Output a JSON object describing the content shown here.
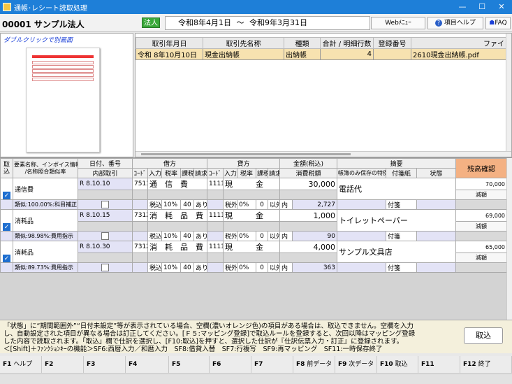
{
  "window": {
    "title": "通帳･レシート読取処理",
    "controls": [
      "—",
      "☐",
      "✕"
    ]
  },
  "header": {
    "company": "00001 サンプル法人",
    "entity_type": "法人",
    "period_start": "令和8年4月1日",
    "period_sep": "〜",
    "period_end": "令和9年3月31日",
    "web_menu": "Webﾒﾆｭｰ",
    "help": "項目ヘルプ",
    "faq": "FAQ"
  },
  "preview": {
    "hint": "ダブルクリックで別画面"
  },
  "list": {
    "columns": [
      "取引年月日",
      "取引先名称",
      "種類",
      "合計 / 明細行数",
      "登録番号",
      "ファイ"
    ],
    "rows": [
      {
        "date": "令和 8年10月10日",
        "name": "現金出納帳",
        "kind": "出納帳",
        "count": "4",
        "reg": "",
        "file": "2610現金出納帳.pdf"
      }
    ]
  },
  "grid": {
    "headers": {
      "tori": "取",
      "komi": "込",
      "element": "要素名称、インボイス情報",
      "element2": "/名称照合類似率",
      "date": "日付、番号",
      "internal": "内部取引",
      "debit": "借方",
      "credit": "貸方",
      "code": "ｺｰﾄﾞ",
      "input": "入力",
      "taxrate": "税率",
      "taxcls": "課税",
      "bill": "請求",
      "amount": "金額(税込)",
      "tax": "消費税額",
      "summary": "摘要",
      "special": "帳簿のみ保存の特例",
      "tag": "付箋紙",
      "state": "状態",
      "balance": "残高確認"
    },
    "rows": [
      {
        "name": "通信費",
        "match": "類似:100.00%:科目補正",
        "era": "R",
        "m": "8",
        "d": "10",
        "n": "10",
        "dr_code": "7513",
        "dr_name": "通　信　費",
        "dr_input": "税込",
        "dr_rate": "10%",
        "dr_cls": "40",
        "dr_bill": "あり",
        "cr_code": "1111",
        "cr_name": "現　　　金",
        "cr_input": "税外",
        "cr_rate": "0%",
        "cr_cls": "0",
        "cr_bill": "以外",
        "amount": "30,000",
        "in": "内",
        "tax": "2,727",
        "summary": "電話代",
        "tag": "付箋",
        "balance": "70,000",
        "reduce": "減額"
      },
      {
        "name": "消耗品",
        "match": "類似:98.98%:費用指示",
        "era": "R",
        "m": "8",
        "d": "10",
        "n": "15",
        "dr_code": "7312",
        "dr_name": "消　耗　品　費",
        "dr_input": "税込",
        "dr_rate": "10%",
        "dr_cls": "40",
        "dr_bill": "あり",
        "cr_code": "1111",
        "cr_name": "現　　　金",
        "cr_input": "税外",
        "cr_rate": "0%",
        "cr_cls": "0",
        "cr_bill": "以外",
        "amount": "1,000",
        "in": "内",
        "tax": "90",
        "summary": "トイレットペーパー",
        "tag": "付箋",
        "balance": "69,000",
        "reduce": "減額"
      },
      {
        "name": "消耗品",
        "match": "類似:89.73%:費用指示",
        "era": "R",
        "m": "8",
        "d": "10",
        "n": "30",
        "dr_code": "7312",
        "dr_name": "消　耗　品　費",
        "dr_input": "税込",
        "dr_rate": "10%",
        "dr_cls": "40",
        "dr_bill": "あり",
        "cr_code": "1111",
        "cr_name": "現　　　金",
        "cr_input": "税外",
        "cr_rate": "0%",
        "cr_cls": "0",
        "cr_bill": "以外",
        "amount": "4,000",
        "in": "内",
        "tax": "363",
        "summary": "サンプル文具店",
        "tag": "付箋",
        "balance": "65,000",
        "reduce": "減額"
      }
    ]
  },
  "message": {
    "line1": "「状態」に“期間範囲外”“日付未設定”等が表示されている場合、空欄(濃いオレンジ色)の項目がある場合は、取込できません。空欄を入力",
    "line2": "し、自動設定された項目が異なる場合は訂正してください。[Ｆ５:マッピング登録]で取込ルールを登録すると、次回以降はマッピング登録",
    "line3": "した内容で読取されます。「取込」欄で仕訳を選択し、[F10:取込]を押すと、選択した仕訳が『仕訳伝票入力・訂正』に登録されます。",
    "line4": "＜[Shift]＋ﾌｧﾝｸｼｮﾝｷｰの機能＞SF6:西暦入力／和暦入力　SF8:借貸入替　SF7:行複写　SF9:再マッピング　SF11:一時保存終了",
    "import_button": "取込"
  },
  "fkeys": [
    {
      "key": "F1",
      "label": "ヘルプ"
    },
    {
      "key": "F2",
      "label": ""
    },
    {
      "key": "F3",
      "label": ""
    },
    {
      "key": "F4",
      "label": ""
    },
    {
      "key": "F5",
      "label": ""
    },
    {
      "key": "F6",
      "label": ""
    },
    {
      "key": "F7",
      "label": ""
    },
    {
      "key": "F8",
      "label": "前データ"
    },
    {
      "key": "F9",
      "label": "次データ"
    },
    {
      "key": "F10",
      "label": "取込"
    },
    {
      "key": "F11",
      "label": ""
    },
    {
      "key": "F12",
      "label": "終了"
    }
  ],
  "colors": {
    "titlebar": "#1e7fd8",
    "selected_row": "#f7e2b0",
    "balance_header": "#f4b183",
    "hint": "#1a3fd8"
  }
}
